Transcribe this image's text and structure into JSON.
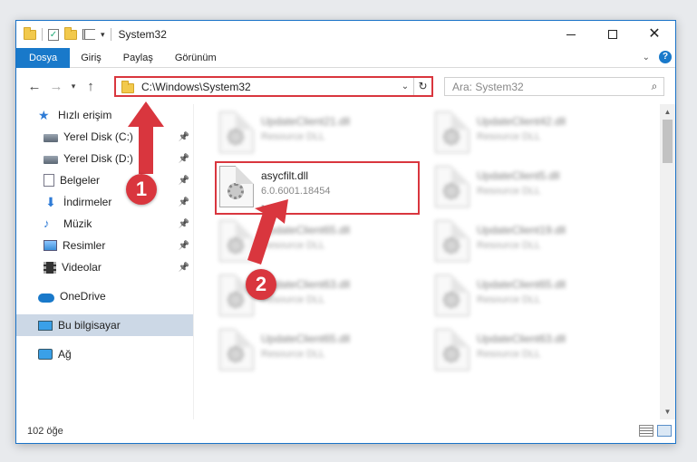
{
  "window": {
    "title": "System32",
    "controls": {
      "minimize": "—",
      "maximize": "□",
      "close": "✕"
    }
  },
  "ribbon": {
    "tabs": [
      "Dosya",
      "Giriş",
      "Paylaş",
      "Görünüm"
    ],
    "active": "Dosya",
    "expand_icon": "chevron-down-icon",
    "help_label": "?"
  },
  "nav": {
    "address": "C:\\Windows\\System32",
    "search_placeholder": "Ara: System32"
  },
  "sidebar": {
    "items": [
      {
        "label": "Hızlı erişim",
        "icon": "star-icon",
        "pinned": false,
        "selected": false,
        "indent": 1
      },
      {
        "label": "Yerel Disk (C:)",
        "icon": "drive-icon",
        "pinned": true,
        "selected": false,
        "indent": 2
      },
      {
        "label": "Yerel Disk (D:)",
        "icon": "drive-icon",
        "pinned": true,
        "selected": false,
        "indent": 2
      },
      {
        "label": "Belgeler",
        "icon": "documents-icon",
        "pinned": true,
        "selected": false,
        "indent": 2
      },
      {
        "label": "İndirmeler",
        "icon": "download-icon",
        "pinned": true,
        "selected": false,
        "indent": 2
      },
      {
        "label": "Müzik",
        "icon": "music-icon",
        "pinned": true,
        "selected": false,
        "indent": 2
      },
      {
        "label": "Resimler",
        "icon": "pictures-icon",
        "pinned": true,
        "selected": false,
        "indent": 2
      },
      {
        "label": "Videolar",
        "icon": "videos-icon",
        "pinned": true,
        "selected": false,
        "indent": 2
      },
      {
        "label": "OneDrive",
        "icon": "onedrive-icon",
        "pinned": false,
        "selected": false,
        "indent": 1,
        "gap": true
      },
      {
        "label": "Bu bilgisayar",
        "icon": "this-pc-icon",
        "pinned": false,
        "selected": true,
        "indent": 1,
        "gap": true
      },
      {
        "label": "Ağ",
        "icon": "network-icon",
        "pinned": false,
        "selected": false,
        "indent": 1,
        "gap": true
      }
    ]
  },
  "files": [
    {
      "name": "UpdateClient21.dll",
      "sub": "Resource DLL",
      "blurred": true
    },
    {
      "name": "UpdateClient42.dll",
      "sub": "Resource DLL",
      "blurred": true
    },
    {
      "name": "asycfilt.dll",
      "sub": "6.0.6001.18454",
      "sub2": "-",
      "blurred": false
    },
    {
      "name": "UpdateClient5.dll",
      "sub": "Resource DLL",
      "blurred": true
    },
    {
      "name": "UpdateClient65.dll",
      "sub": "Resource DLL",
      "blurred": true
    },
    {
      "name": "UpdateClient19.dll",
      "sub": "Resource DLL",
      "blurred": true
    },
    {
      "name": "UpdateClient63.dll",
      "sub": "Resource DLL",
      "blurred": true
    },
    {
      "name": "UpdateClient65.dll",
      "sub": "Resource DLL",
      "blurred": true
    },
    {
      "name": "UpdateClient65.dll",
      "sub": "Resource DLL",
      "blurred": true
    },
    {
      "name": "UpdateClient63.dll",
      "sub": "Resource DLL",
      "blurred": true
    }
  ],
  "status": {
    "count": "102 öğe"
  },
  "callouts": [
    {
      "label": "1"
    },
    {
      "label": "2"
    }
  ],
  "colors": {
    "accent": "#1979ca",
    "highlight": "#d9363e",
    "selected_nav": "#ccd8e6"
  }
}
